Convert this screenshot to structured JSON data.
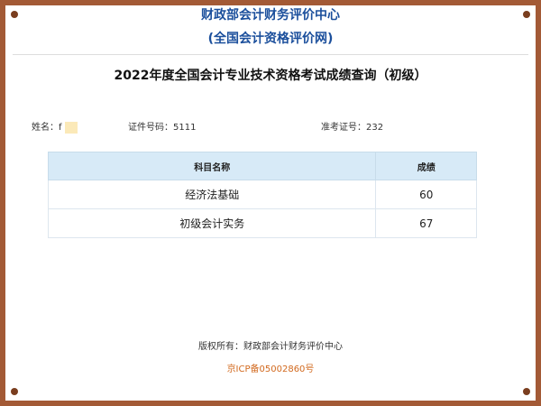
{
  "header": {
    "org_name": "财政部会计财务评价中心",
    "site_name": "(全国会计资格评价网)"
  },
  "page_title": "2022年度全国会计专业技术资格考试成绩查询（初级）",
  "candidate": {
    "name_label": "姓名：",
    "name_value": "f",
    "id_label": "证件号码：",
    "id_value": "5111",
    "exam_no_label": "准考证号：",
    "exam_no_value": "232"
  },
  "score_table": {
    "headers": [
      "科目名称",
      "成绩"
    ],
    "rows": [
      [
        "经济法基础",
        "60"
      ],
      [
        "初级会计实务",
        "67"
      ]
    ]
  },
  "footer": {
    "copyright": "版权所有：财政部会计财务评价中心",
    "icp": "京ICP备05002860号"
  },
  "colors": {
    "frame": "#a35a36",
    "header_text": "#1b4f9c",
    "table_header_bg": "#d7eaf7",
    "icp_link": "#d2691e"
  }
}
